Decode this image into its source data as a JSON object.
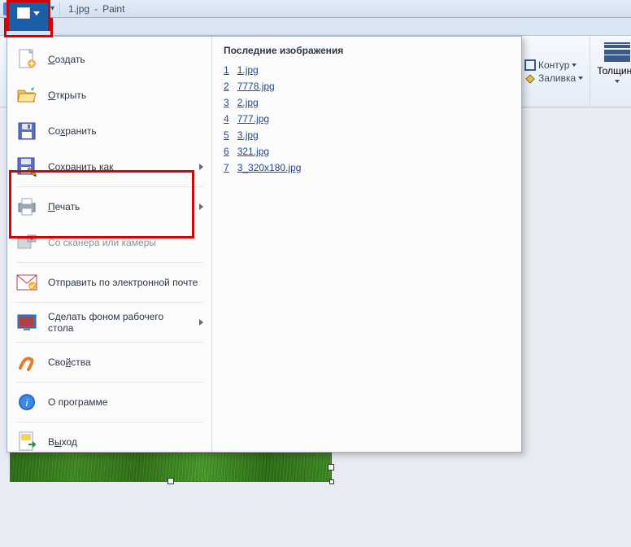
{
  "titlebar": {
    "filename": "1.jpg",
    "app": "Paint",
    "sep": "-"
  },
  "ribbon": {
    "outline_label": "Контур",
    "fill_label": "Заливка",
    "thickness_label": "Толщина"
  },
  "menu": {
    "create": "Создать",
    "open": "Открыть",
    "save": "Сохранить",
    "saveas": "Сохранить как",
    "print": "Печать",
    "scanner": "Со сканера или камеры",
    "email": "Отправить по электронной почте",
    "desktop": "Сделать фоном рабочего стола",
    "properties": "Свойства",
    "about": "О программе",
    "exit": "Выход"
  },
  "recent": {
    "title": "Последние изображения",
    "items": [
      {
        "n": "1",
        "name": "1.jpg"
      },
      {
        "n": "2",
        "name": "7778.jpg"
      },
      {
        "n": "3",
        "name": "2.jpg"
      },
      {
        "n": "4",
        "name": "777.jpg"
      },
      {
        "n": "5",
        "name": "3.jpg"
      },
      {
        "n": "6",
        "name": "321.jpg"
      },
      {
        "n": "7",
        "name": "3_320x180.jpg"
      }
    ]
  },
  "colors": {
    "highlight": "#d40303",
    "filebtn": "#1b5fa6"
  }
}
